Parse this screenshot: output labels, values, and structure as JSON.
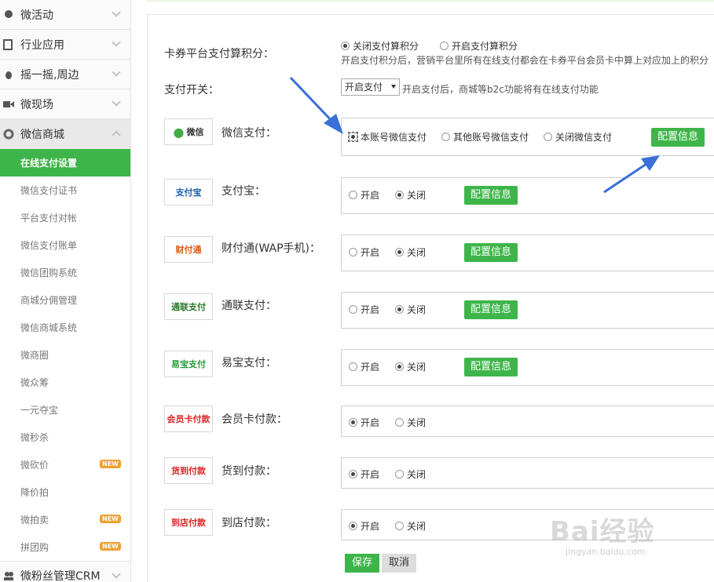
{
  "sidebar": {
    "top_items": [
      {
        "label": "微活动",
        "icon": "bulb-icon"
      },
      {
        "label": "行业应用",
        "icon": "book-icon"
      },
      {
        "label": "摇一摇,周边",
        "icon": "bug-icon"
      },
      {
        "label": "微现场",
        "icon": "video-icon"
      },
      {
        "label": "微信商城",
        "icon": "gear-icon"
      }
    ],
    "sub_items": [
      {
        "label": "在线支付设置",
        "active": true
      },
      {
        "label": "微信支付证书"
      },
      {
        "label": "平台支付对帐"
      },
      {
        "label": "微信支付账单"
      },
      {
        "label": "微信团购系统"
      },
      {
        "label": "商城分佣管理"
      },
      {
        "label": "微信商城系统"
      },
      {
        "label": "微商圈"
      },
      {
        "label": "微众筹"
      },
      {
        "label": "一元夺宝"
      },
      {
        "label": "微秒杀"
      },
      {
        "label": "微砍价",
        "badge": "NEW"
      },
      {
        "label": "降价拍"
      },
      {
        "label": "微拍卖",
        "badge": "NEW"
      },
      {
        "label": "拼团购",
        "badge": "NEW"
      }
    ],
    "bottom_item": {
      "label": "微粉丝管理CRM",
      "icon": "users-icon"
    }
  },
  "form": {
    "points": {
      "label": "卡券平台支付算积分：",
      "opt_off": "关闭支付算积分",
      "opt_on": "开启支付算积分",
      "hint": "开启支付积分后，营销平台里所有在线支付都会在卡券平台会员卡中算上对应加上的积分"
    },
    "switch": {
      "label": "支付开关：",
      "value": "开启支付",
      "hint": "开启支付后，商城等b2c功能将有在线支付功能"
    },
    "wechat": {
      "logo": "微信",
      "label": "微信支付：",
      "opt1": "本账号微信支付",
      "opt2": "其他账号微信支付",
      "opt3": "关闭微信支付",
      "config": "配置信息"
    },
    "payments": [
      {
        "logo": "支付宝",
        "label": "支付宝：",
        "on": "开启",
        "off": "关闭",
        "config": "配置信息",
        "selected": "off"
      },
      {
        "logo": "财付通",
        "label": "财付通(WAP手机)：",
        "on": "开启",
        "off": "关闭",
        "config": "配置信息",
        "selected": "off"
      },
      {
        "logo": "通联支付",
        "label": "通联支付：",
        "on": "开启",
        "off": "关闭",
        "config": "配置信息",
        "selected": "off"
      },
      {
        "logo": "易宝支付",
        "label": "易宝支付：",
        "on": "开启",
        "off": "关闭",
        "config": "配置信息",
        "selected": "off"
      },
      {
        "logo": "会员卡付款",
        "label": "会员卡付款：",
        "on": "开启",
        "off": "关闭",
        "selected": "on"
      },
      {
        "logo": "货到付款",
        "label": "货到付款：",
        "on": "开启",
        "off": "关闭",
        "selected": "on"
      },
      {
        "logo": "到店付款",
        "label": "到店付款：",
        "on": "开启",
        "off": "关闭",
        "selected": "on"
      }
    ],
    "save": "保存",
    "cancel": "取消"
  },
  "watermark": {
    "main": "Bai经验",
    "sub": "jingyan.baidu.com"
  },
  "colors": {
    "accent": "#3eb54a",
    "arrow": "#3a6fd8"
  }
}
